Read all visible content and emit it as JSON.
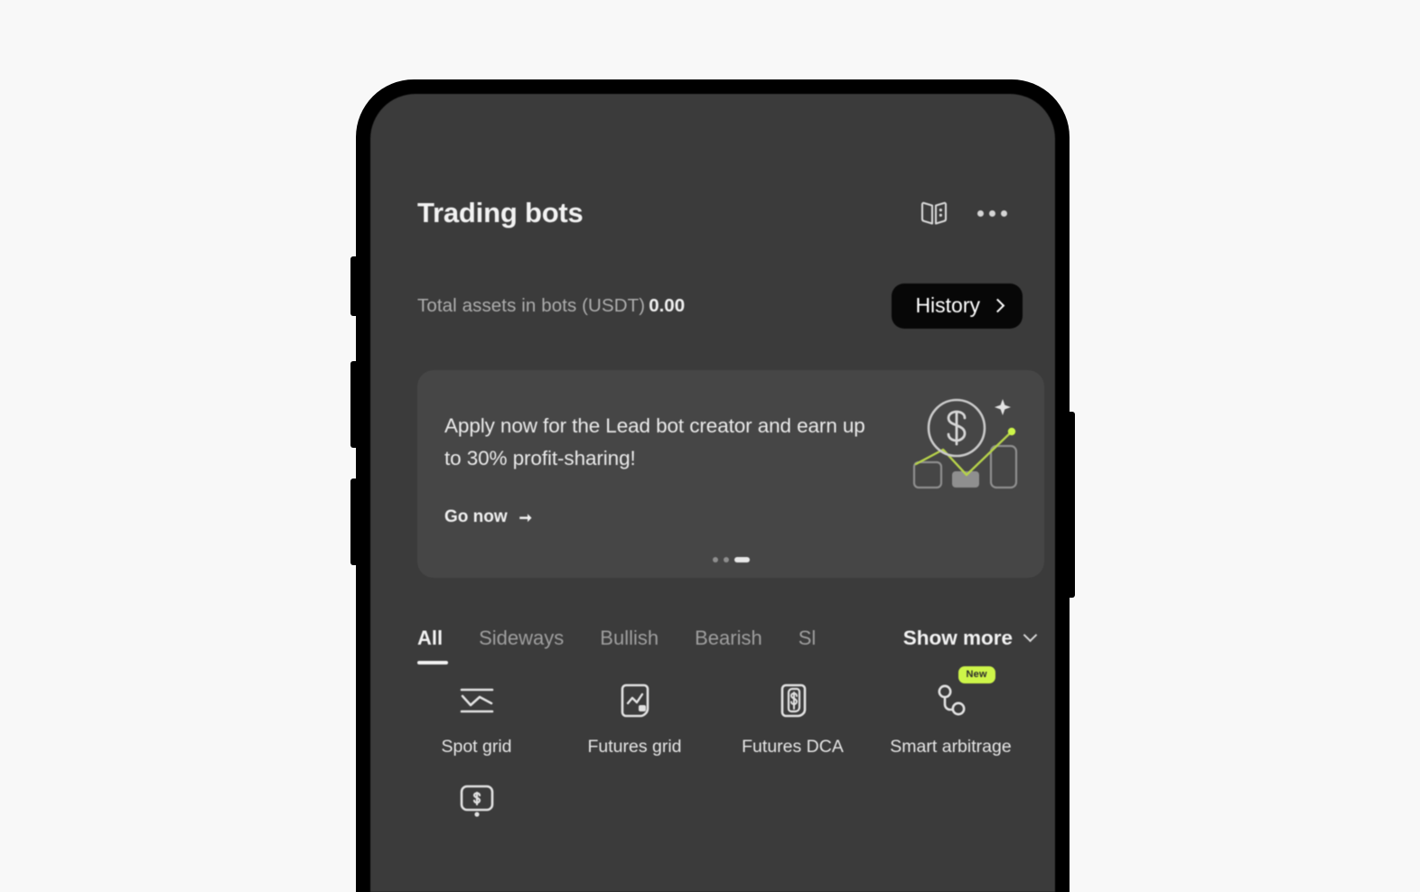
{
  "device": {
    "type": "smartphone-mockup",
    "frame_color": "#000000",
    "screen_bg": "#3b3b3b",
    "page_bg": "#f8f8f8"
  },
  "header": {
    "title": "Trading bots",
    "guide_icon": "open-book-icon",
    "menu_icon": "more-options-icon"
  },
  "assets": {
    "label": "Total assets in bots (USDT)",
    "value": "0.00",
    "history_label": "History",
    "history_chevron": "chevron-right-icon"
  },
  "promo": {
    "text": "Apply now for the Lead bot creator and earn up to 30% profit-sharing!",
    "cta_label": "Go now",
    "cta_icon": "arrow-right-icon",
    "illustration": "dollar-coin-growth-chart-icon",
    "accent_color": "#cdf549",
    "carousel": {
      "total": 3,
      "active_index": 2
    }
  },
  "tabs": {
    "items": [
      {
        "label": "All",
        "active": true
      },
      {
        "label": "Sideways",
        "active": false
      },
      {
        "label": "Bullish",
        "active": false
      },
      {
        "label": "Bearish",
        "active": false
      },
      {
        "label": "Sl",
        "active": false,
        "truncated": true
      }
    ],
    "show_more_label": "Show more",
    "show_more_icon": "chevron-down-icon"
  },
  "bots": {
    "items": [
      {
        "label": "Spot grid",
        "icon": "spot-grid-icon",
        "badge": null
      },
      {
        "label": "Futures grid",
        "icon": "futures-grid-icon",
        "badge": null
      },
      {
        "label": "Futures DCA",
        "icon": "futures-dca-icon",
        "badge": null
      },
      {
        "label": "Smart arbitrage",
        "icon": "smart-arbitrage-icon",
        "badge": "New"
      },
      {
        "label": "",
        "icon": "screen-dollar-icon",
        "badge": null
      }
    ],
    "badge_color": "#cdf549"
  }
}
